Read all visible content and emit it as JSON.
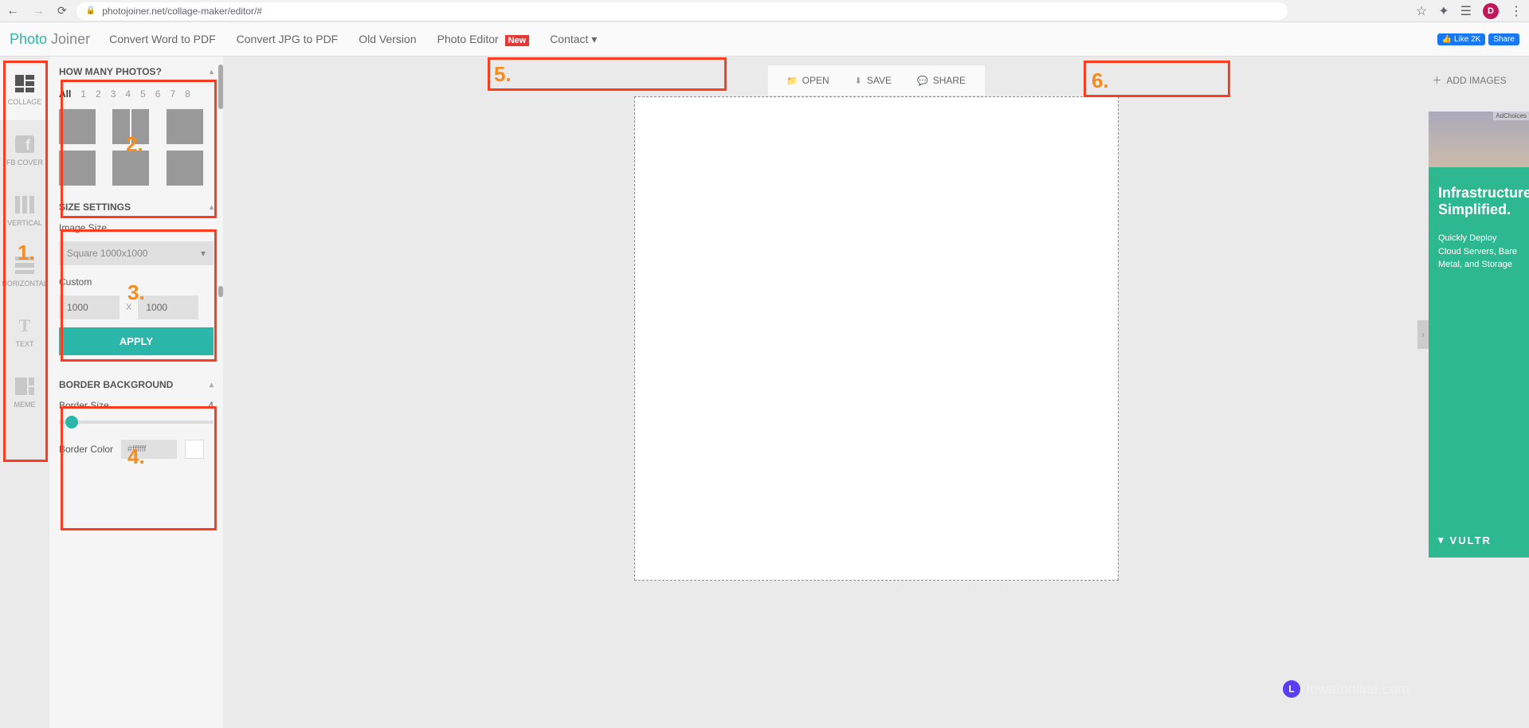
{
  "browser": {
    "url": "photojoiner.net/collage-maker/editor/#",
    "avatar_letter": "D"
  },
  "nav": {
    "logo_part1": "Photo ",
    "logo_part2": "Joiner",
    "links": [
      "Convert Word to PDF",
      "Convert JPG to PDF",
      "Old Version",
      "Photo Editor",
      "Contact "
    ],
    "new_badge": "New",
    "fb_like": "Like 2K",
    "fb_share": "Share"
  },
  "rail": {
    "items": [
      {
        "label": "COLLAGE"
      },
      {
        "label": "FB COVER"
      },
      {
        "label": "VERTICAL"
      },
      {
        "label": "HORIZONTAL"
      },
      {
        "label": "TEXT"
      },
      {
        "label": "MEME"
      }
    ]
  },
  "panel": {
    "photos_header": "HOW MANY PHOTOS?",
    "photo_tabs": [
      "All",
      "1",
      "2",
      "3",
      "4",
      "5",
      "6",
      "7",
      "8"
    ],
    "size_header": "SIZE SETTINGS",
    "image_size_label": "Image Size",
    "image_size_value": "Square 1000x1000",
    "custom_label": "Custom",
    "width_value": "1000",
    "height_value": "1000",
    "x_label": "X",
    "apply_label": "APPLY",
    "border_header": "BORDER BACKGROUND",
    "border_size_label": "Border Size",
    "border_size_value": "4",
    "border_color_label": "Border Color",
    "border_color_value": "#ffffff"
  },
  "toolbar": {
    "open": "OPEN",
    "save": "SAVE",
    "share": "SHARE"
  },
  "add_images": "ADD IMAGES",
  "ad": {
    "title": "Infrastructure Simplified.",
    "subtitle": "Quickly Deploy Cloud Servers, Bare Metal, and Storage",
    "brand": "VULTR",
    "choices": "AdChoices"
  },
  "annotations": {
    "n1": "1.",
    "n2": "2.",
    "n3": "3.",
    "n4": "4.",
    "n5": "5.",
    "n6": "6."
  },
  "watermark": {
    "badge": "L",
    "text": "lewatonline.com"
  }
}
